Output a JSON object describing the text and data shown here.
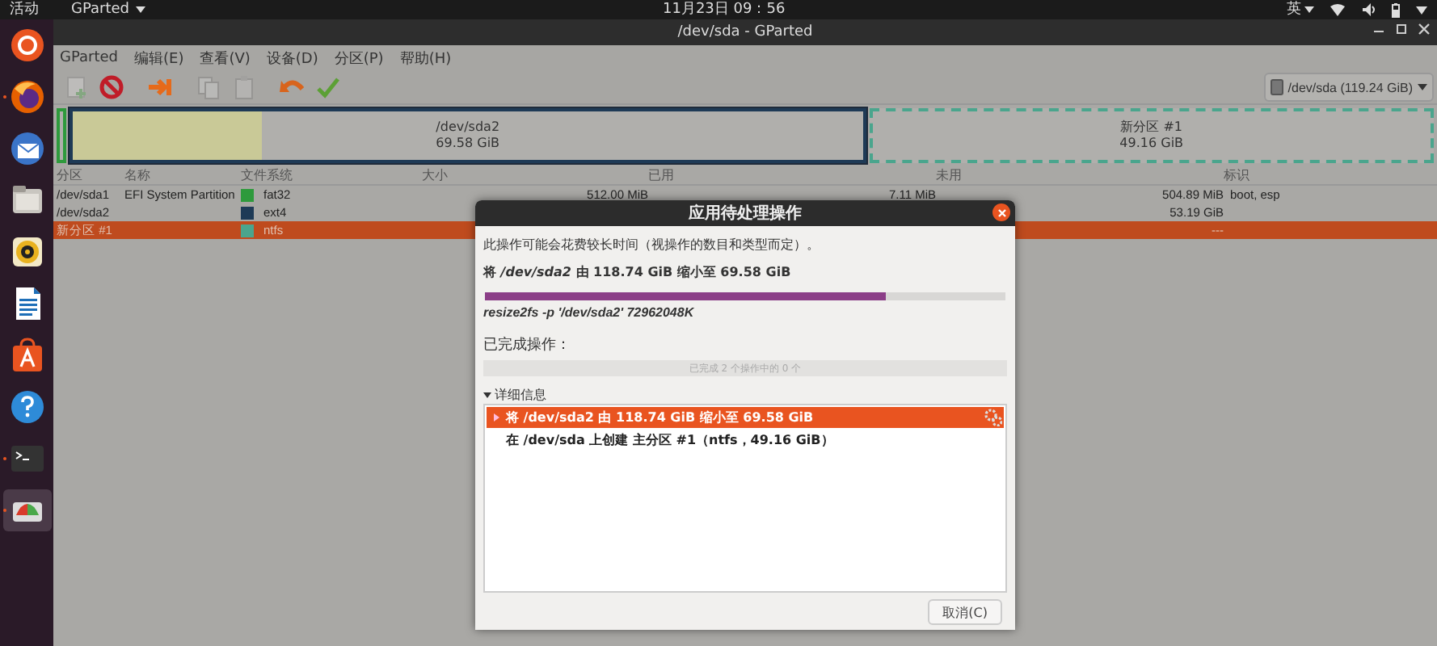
{
  "top_bar": {
    "activities": "活动",
    "app_menu": "GParted",
    "clock": "11月23日  09：56",
    "input_method": "英"
  },
  "dock": [
    {
      "kind": "ubuntu",
      "running": false,
      "selected": false
    },
    {
      "kind": "firefox",
      "running": true,
      "selected": false
    },
    {
      "kind": "mail",
      "running": false,
      "selected": false
    },
    {
      "kind": "files",
      "running": false,
      "selected": false
    },
    {
      "kind": "music",
      "running": false,
      "selected": false
    },
    {
      "kind": "writer",
      "running": false,
      "selected": false
    },
    {
      "kind": "store",
      "running": false,
      "selected": false
    },
    {
      "kind": "help",
      "running": false,
      "selected": false
    },
    {
      "kind": "terminal",
      "running": true,
      "selected": false
    },
    {
      "kind": "gparted",
      "running": true,
      "selected": true
    }
  ],
  "window": {
    "title": "/dev/sda - GParted"
  },
  "menu_bar": [
    "GParted",
    "编辑(E)",
    "查看(V)",
    "设备(D)",
    "分区(P)",
    "帮助(H)"
  ],
  "toolbar": [
    {
      "kind": "new",
      "disabled": true
    },
    {
      "kind": "delete",
      "disabled": false
    },
    {
      "kind": "resize",
      "disabled": false
    },
    {
      "kind": "copy",
      "disabled": true
    },
    {
      "kind": "paste",
      "disabled": true
    },
    {
      "kind": "undo",
      "disabled": false
    },
    {
      "kind": "apply",
      "disabled": false
    }
  ],
  "device_selector": "/dev/sda (119.24 GiB)",
  "partition_map": [
    {
      "kind": "small",
      "selected": false
    },
    {
      "kind": "partition",
      "label": "/dev/sda2",
      "size": "69.58 GiB",
      "selected": true,
      "level": 0.24
    },
    {
      "kind": "new",
      "label": "新分区 #1",
      "size": "49.16 GiB",
      "selected": false
    }
  ],
  "table": {
    "columns": [
      "分区",
      "名称",
      "文件系统",
      "大小",
      "已用",
      "未用",
      "标识"
    ],
    "rows": [
      {
        "partition": "/dev/sda1",
        "name": "EFI System Partition",
        "filesystem": "fat32",
        "color": "#2e9a3c",
        "size": "512.00 MiB",
        "used": "7.11 MiB",
        "unused": "504.89 MiB",
        "flags": "boot, esp",
        "selected": false
      },
      {
        "partition": "/dev/sda2",
        "filesystem": "ext4",
        "color": "#1e3a56",
        "unused": "53.19 GiB",
        "selected": false
      },
      {
        "partition": "新分区 #1",
        "filesystem": "ntfs",
        "color": "#4aa58d",
        "unused": "---",
        "selected": true
      }
    ]
  },
  "dialog": {
    "title": "应用待处理操作",
    "note": "此操作可能会花费较长时间（视操作的数目和类型而定）。",
    "operation": "将 */dev/sda2* 由 118.74 GiB 缩小至 69.58 GiB",
    "progress": {
      "level": 0.77
    },
    "command": "resize2fs -p '/dev/sda2' 72962048K",
    "completed_label": "已完成操作：",
    "completed_progress": {
      "level": 0,
      "text": "已完成 2 个操作中的 0 个"
    },
    "details": {
      "label": "详细信息",
      "expanded": true,
      "items": [
        {
          "text": "将 /dev/sda2 由 118.74 GiB 缩小至 69.58 GiB",
          "selected": true,
          "expanded": false,
          "running": true
        },
        {
          "text": "在 /dev/sda 上创建 主分区 #1（ntfs，49.16 GiB）",
          "selected": false,
          "running": false
        }
      ]
    },
    "cancel": "取消(C)"
  }
}
